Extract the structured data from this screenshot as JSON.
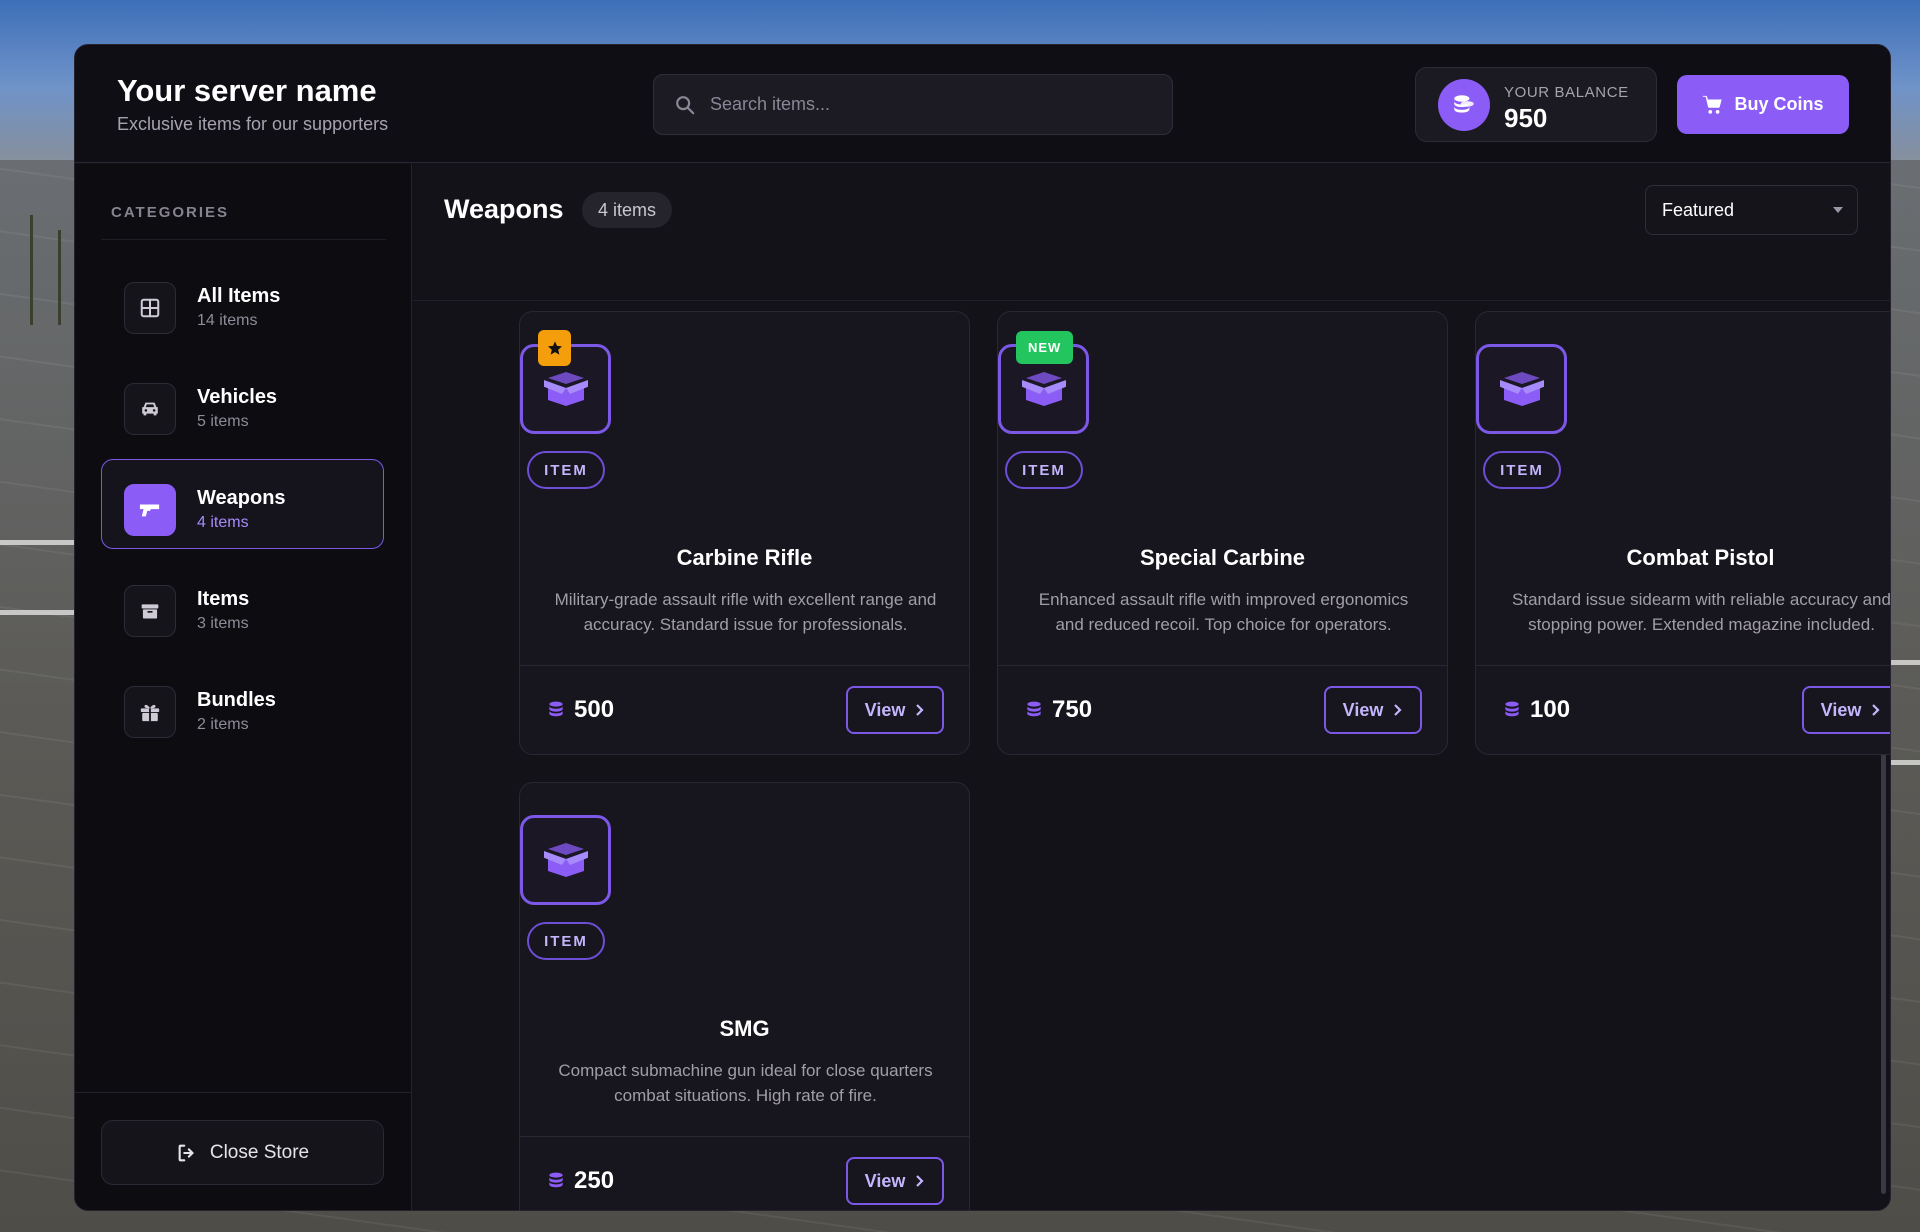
{
  "header": {
    "title": "Your server name",
    "subtitle": "Exclusive items for our supporters",
    "search_placeholder": "Search items...",
    "balance_label": "YOUR BALANCE",
    "balance_value": "950",
    "buy_label": "Buy Coins"
  },
  "sidebar": {
    "heading": "CATEGORIES",
    "items": [
      {
        "label": "All Items",
        "count": "14 items",
        "icon": "grid-icon"
      },
      {
        "label": "Vehicles",
        "count": "5 items",
        "icon": "car-icon"
      },
      {
        "label": "Weapons",
        "count": "4 items",
        "icon": "gun-icon",
        "active": true
      },
      {
        "label": "Items",
        "count": "3 items",
        "icon": "box-icon"
      },
      {
        "label": "Bundles",
        "count": "2 items",
        "icon": "gift-icon"
      }
    ],
    "close_label": "Close Store"
  },
  "main": {
    "title": "Weapons",
    "count": "4 items",
    "sort_value": "Featured",
    "cards": [
      {
        "name": "Carbine Rifle",
        "type": "ITEM",
        "badge": "star",
        "desc": "Military-grade assault rifle with excellent range and accuracy. Standard issue for professionals.",
        "price": "500",
        "view": "View"
      },
      {
        "name": "Special Carbine",
        "type": "ITEM",
        "badge": "NEW",
        "desc": "Enhanced assault rifle with improved ergonomics and reduced recoil. Top choice for operators.",
        "price": "750",
        "view": "View"
      },
      {
        "name": "Combat Pistol",
        "type": "ITEM",
        "badge": "",
        "desc": "Standard issue sidearm with reliable accuracy and stopping power. Extended magazine included.",
        "price": "100",
        "view": "View"
      },
      {
        "name": "SMG",
        "type": "ITEM",
        "badge": "",
        "desc": "Compact submachine gun ideal for close quarters combat situations. High rate of fire.",
        "price": "250",
        "view": "View"
      }
    ]
  },
  "colors": {
    "accent": "#8b5cf6",
    "new_badge": "#22c55e",
    "star_badge": "#f59e0b",
    "panel": "#121018"
  }
}
